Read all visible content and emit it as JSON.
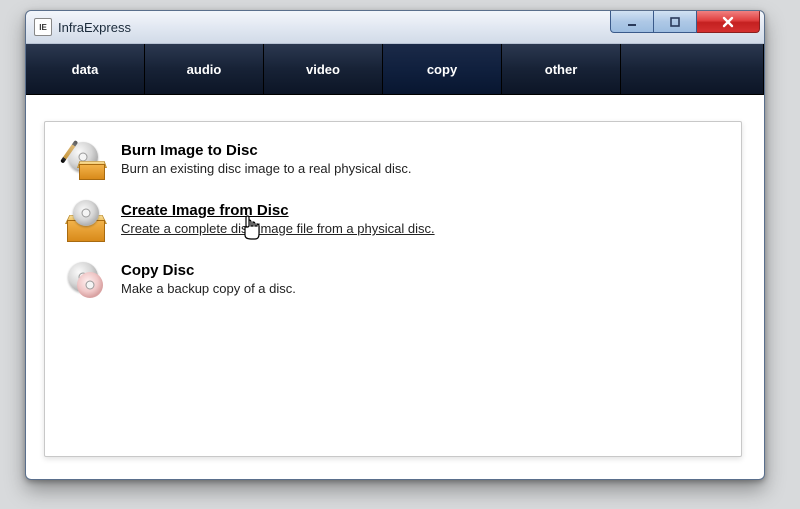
{
  "window": {
    "title": "InfraExpress",
    "icon_label": "IE"
  },
  "tabs": [
    {
      "id": "data",
      "label": "data"
    },
    {
      "id": "audio",
      "label": "audio"
    },
    {
      "id": "video",
      "label": "video"
    },
    {
      "id": "copy",
      "label": "copy",
      "active": true
    },
    {
      "id": "other",
      "label": "other"
    }
  ],
  "options": [
    {
      "id": "burn-image",
      "title": "Burn Image to Disc",
      "desc": "Burn an existing disc image to a real physical disc."
    },
    {
      "id": "create-image",
      "title": "Create Image from Disc",
      "desc": "Create a complete disc image file from a physical disc.",
      "hovered": true
    },
    {
      "id": "copy-disc",
      "title": "Copy Disc",
      "desc": "Make a backup copy of a disc."
    }
  ]
}
